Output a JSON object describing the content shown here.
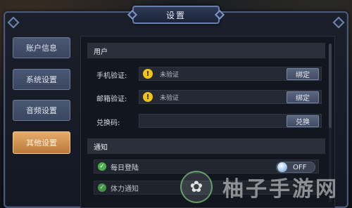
{
  "title": "设置",
  "sidebar": {
    "items": [
      {
        "label": "账户信息",
        "active": false
      },
      {
        "label": "系统设置",
        "active": false
      },
      {
        "label": "音频设置",
        "active": false
      },
      {
        "label": "其他设置",
        "active": true
      }
    ]
  },
  "sections": {
    "user": {
      "title": "用户",
      "phone": {
        "label": "手机验证:",
        "value": "未验证",
        "button": "绑定"
      },
      "email": {
        "label": "邮箱验证:",
        "value": "未验证",
        "button": "绑定"
      },
      "redeem": {
        "label": "兑换码:",
        "value": "",
        "button": "兑换"
      }
    },
    "notify": {
      "title": "通知",
      "items": [
        {
          "label": "每日登陆",
          "state": "OFF"
        },
        {
          "label": "体力通知",
          "state": ""
        }
      ]
    }
  },
  "watermark": {
    "text": "柚子手游网"
  },
  "colors": {
    "accent": "#e6ab6a",
    "warning": "#f1c40f",
    "check": "#4caf50",
    "panel_border": "#4a5a78"
  },
  "icons": {
    "warning": "warning-icon",
    "check": "check-icon"
  }
}
